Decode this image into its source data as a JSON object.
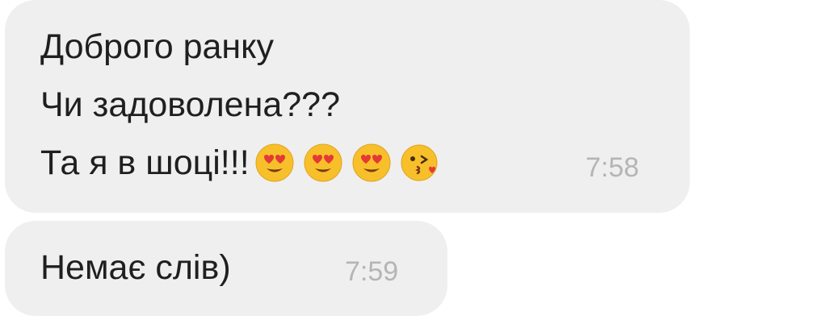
{
  "messages": [
    {
      "lines": [
        "Доброго ранку",
        "Чи задоволена???",
        "Та я в шоці!!!"
      ],
      "emojis": [
        "heart-eyes-emoji",
        "heart-eyes-emoji",
        "heart-eyes-emoji",
        "kissing-heart-emoji"
      ],
      "time": "7:58"
    },
    {
      "text": "Немає слів)",
      "time": "7:59"
    }
  ],
  "colors": {
    "bubble": "#efefef",
    "text": "#1f1f1f",
    "timestamp": "#b5b5b5",
    "emoji_face": "#f7c02b",
    "emoji_heart": "#e53935"
  }
}
